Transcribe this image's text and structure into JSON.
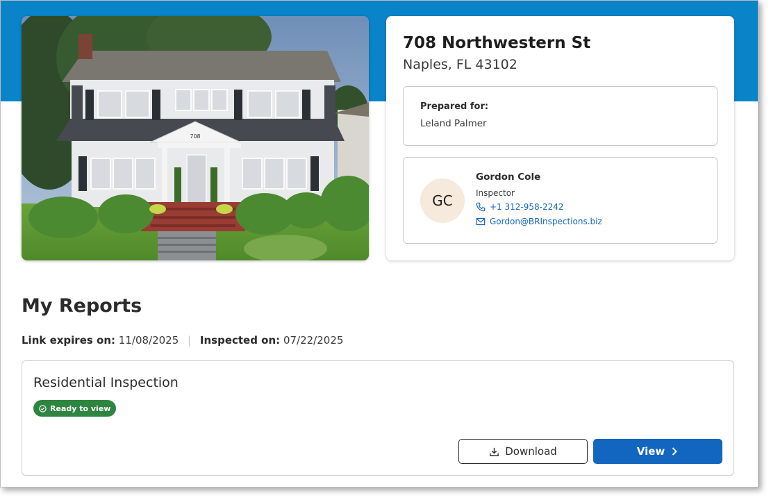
{
  "property": {
    "address_line1": "708 Northwestern St",
    "address_line2": "Naples, FL 43102",
    "photo_icon": "house-photo"
  },
  "prepared_for": {
    "label": "Prepared for:",
    "name": "Leland Palmer"
  },
  "inspector": {
    "initials": "GC",
    "name": "Gordon Cole",
    "role": "Inspector",
    "phone": "+1 312-958-2242",
    "email": "Gordon@BRInspections.biz",
    "phone_icon": "phone-icon",
    "email_icon": "mail-icon"
  },
  "reports_section": {
    "heading": "My Reports",
    "link_expires_label": "Link expires on:",
    "link_expires_value": "11/08/2025",
    "separator": "|",
    "inspected_label": "Inspected on:",
    "inspected_value": "07/22/2025"
  },
  "report": {
    "title": "Residential Inspection",
    "status_badge": "Ready to view",
    "download_label": "Download",
    "view_label": "View"
  },
  "colors": {
    "header_band": "#0a84c8",
    "primary_button": "#1266c0",
    "status_badge": "#2e8540",
    "avatar_bg": "#f5eadb",
    "link": "#1565c0"
  }
}
